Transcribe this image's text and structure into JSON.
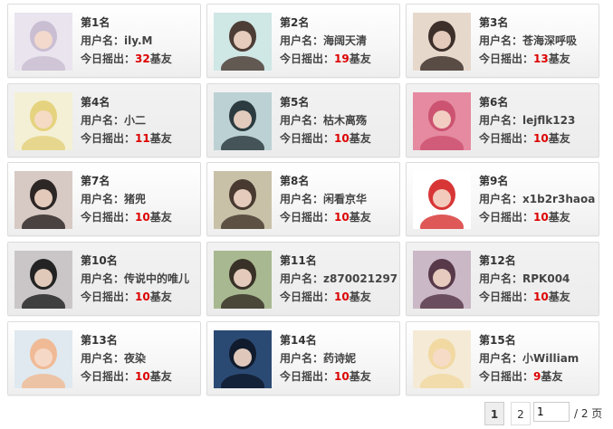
{
  "labels": {
    "username_prefix": "用户名：",
    "today_prefix": "今日摇出：",
    "today_suffix": "基友"
  },
  "colors": {
    "count": "#d00000",
    "card_border": "#dcdcdc"
  },
  "cards": [
    {
      "rank": "第1名",
      "username": "ily.M",
      "count": "32",
      "avatar_icon": "anime-girl-avatar",
      "bg": "#e9e4ee",
      "fg": "#c7b9cf"
    },
    {
      "rank": "第2名",
      "username": "海阔天清",
      "count": "19",
      "avatar_icon": "girl-photo-avatar",
      "bg": "#cfe7e5",
      "fg": "#3d2a22"
    },
    {
      "rank": "第3名",
      "username": "苍海深呼吸",
      "count": "13",
      "avatar_icon": "girl-photo-avatar",
      "bg": "#e7d8cc",
      "fg": "#2a1d18"
    },
    {
      "rank": "第4名",
      "username": "小二",
      "count": "11",
      "avatar_icon": "anime-boy-avatar",
      "bg": "#f4f0d6",
      "fg": "#e3cf76"
    },
    {
      "rank": "第5名",
      "username": "枯木离殇",
      "count": "10",
      "avatar_icon": "dark-winged-avatar",
      "bg": "#bcd1d4",
      "fg": "#1c2a30"
    },
    {
      "rank": "第6名",
      "username": "lejflk123",
      "count": "10",
      "avatar_icon": "patrick-star-avatar",
      "bg": "#e58aa0",
      "fg": "#c94c6c"
    },
    {
      "rank": "第7名",
      "username": "猪兜",
      "count": "10",
      "avatar_icon": "girl-photo-avatar",
      "bg": "#d7c9c3",
      "fg": "#1a1414"
    },
    {
      "rank": "第8名",
      "username": "闲看京华",
      "count": "10",
      "avatar_icon": "girl-field-avatar",
      "bg": "#c8c1a8",
      "fg": "#3a2b22"
    },
    {
      "rank": "第9名",
      "username": "x1b2r3haoa",
      "count": "10",
      "avatar_icon": "rabbit-cartoon-avatar",
      "bg": "#ffffff",
      "fg": "#d42020"
    },
    {
      "rank": "第10名",
      "username": "传说中的唯儿",
      "count": "10",
      "avatar_icon": "girl-photo-avatar",
      "bg": "#cac6c8",
      "fg": "#111111"
    },
    {
      "rank": "第11名",
      "username": "z870021297",
      "count": "10",
      "avatar_icon": "guitar-girl-avatar",
      "bg": "#a8b890",
      "fg": "#2b221c"
    },
    {
      "rank": "第12名",
      "username": "RPK004",
      "count": "10",
      "avatar_icon": "girl-photo-avatar",
      "bg": "#cbb8c6",
      "fg": "#4a2b3c"
    },
    {
      "rank": "第13名",
      "username": "夜染",
      "count": "10",
      "avatar_icon": "cartoon-boy-avatar",
      "bg": "#dfe9ef",
      "fg": "#f2b58c"
    },
    {
      "rank": "第14名",
      "username": "药诗妮",
      "count": "10",
      "avatar_icon": "couple-silhouette-avatar",
      "bg": "#2b4a73",
      "fg": "#0d1626"
    },
    {
      "rank": "第15名",
      "username": "小William",
      "count": "9",
      "avatar_icon": "anime-girl-avatar",
      "bg": "#f4ead6",
      "fg": "#f2d79c"
    }
  ],
  "pager": {
    "page1": "1",
    "page2": "2",
    "input_value": "1",
    "total": "/ 2 页"
  }
}
